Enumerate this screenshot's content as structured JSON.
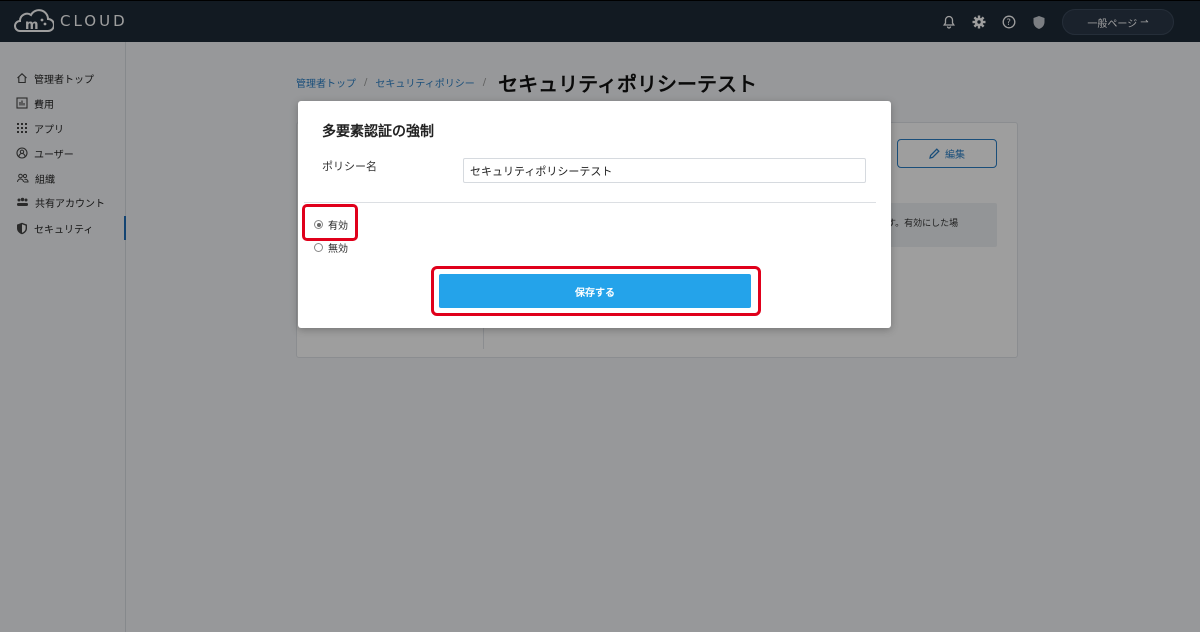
{
  "header": {
    "logo_text": "CLOUD",
    "general_page_label": "一般ページ",
    "general_page_arrow": "⇀",
    "icons": [
      "bell-icon",
      "gear-icon",
      "help-icon",
      "shield-icon"
    ]
  },
  "sidebar": {
    "items": [
      {
        "label": "管理者トップ",
        "icon": "home-icon"
      },
      {
        "label": "費用",
        "icon": "chart-icon"
      },
      {
        "label": "アプリ",
        "icon": "grid-icon"
      },
      {
        "label": "ユーザー",
        "icon": "user-icon"
      },
      {
        "label": "組織",
        "icon": "group-icon"
      },
      {
        "label": "共有アカウント",
        "icon": "shared-account-icon"
      },
      {
        "label": "セキュリティ",
        "icon": "shield-icon"
      }
    ],
    "active_index": 6
  },
  "breadcrumb": {
    "items": [
      "管理者トップ",
      "セキュリティポリシー"
    ],
    "separator": "/",
    "current": "セキュリティポリシーテスト"
  },
  "background_card": {
    "edit_label": "編集",
    "note_text": "す。有効にした場"
  },
  "modal": {
    "title": "多要素認証の強制",
    "policy_name_label": "ポリシー名",
    "policy_name_value": "セキュリティポリシーテスト",
    "options": [
      {
        "label": "有効",
        "checked": true
      },
      {
        "label": "無効",
        "checked": false
      }
    ],
    "save_label": "保存する"
  },
  "colors": {
    "topbar": "#1d2a38",
    "accent": "#24a3ea",
    "link": "#2a7fc6",
    "highlight": "#e0001b"
  }
}
